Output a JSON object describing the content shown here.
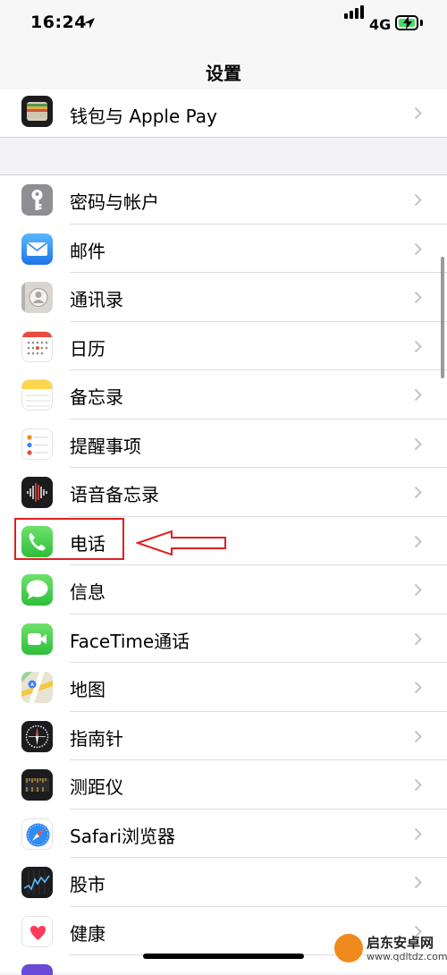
{
  "status": {
    "time": "16:24",
    "network": "4G"
  },
  "nav": {
    "title": "设置"
  },
  "groups": [
    {
      "items": [
        {
          "label": "钱包与 Apple Pay",
          "icon": "wallet-icon"
        }
      ]
    },
    {
      "items": [
        {
          "label": "密码与帐户",
          "icon": "key-icon"
        },
        {
          "label": "邮件",
          "icon": "mail-icon"
        },
        {
          "label": "通讯录",
          "icon": "contacts-icon"
        },
        {
          "label": "日历",
          "icon": "calendar-icon"
        },
        {
          "label": "备忘录",
          "icon": "notes-icon"
        },
        {
          "label": "提醒事项",
          "icon": "reminders-icon"
        },
        {
          "label": "语音备忘录",
          "icon": "voice-memos-icon"
        },
        {
          "label": "电话",
          "icon": "phone-icon"
        },
        {
          "label": "信息",
          "icon": "messages-icon"
        },
        {
          "label": "FaceTime通话",
          "icon": "facetime-icon"
        },
        {
          "label": "地图",
          "icon": "maps-icon"
        },
        {
          "label": "指南针",
          "icon": "compass-icon"
        },
        {
          "label": "测距仪",
          "icon": "measure-icon"
        },
        {
          "label": "Safari浏览器",
          "icon": "safari-icon"
        },
        {
          "label": "股市",
          "icon": "stocks-icon"
        },
        {
          "label": "健康",
          "icon": "health-icon"
        }
      ]
    }
  ],
  "watermark": {
    "name": "启东安卓网",
    "url": "www.qdltdz.com"
  },
  "colors": {
    "highlight": "#e02020",
    "chevron": "#c4c4c7",
    "separator": "#dcdce0"
  }
}
